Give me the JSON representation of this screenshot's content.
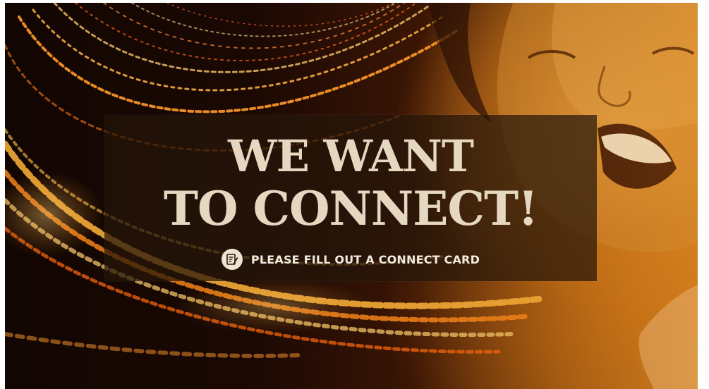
{
  "slide": {
    "headline_line1": "WE WANT",
    "headline_line2": "TO CONNECT!",
    "cta_text": "PLEASE FILL OUT A CONNECT CARD",
    "cta_icon": "connect-card-icon"
  },
  "colors": {
    "headline": "#e6d7c1",
    "banner": "#26160a",
    "accent": "#e8a33a",
    "cta_text": "#f2eadf"
  }
}
